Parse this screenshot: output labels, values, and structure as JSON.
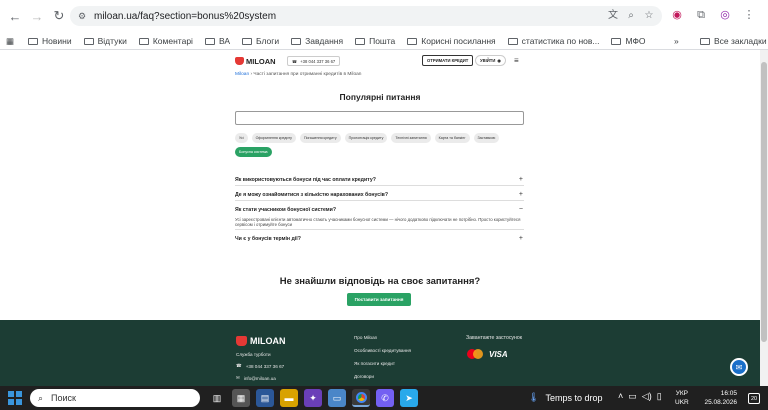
{
  "browser": {
    "url": "miloan.ua/faq?section=bonus%20system",
    "bookmarks": [
      "Новини",
      "Відтуки",
      "Коментарі",
      "ВА",
      "Блоги",
      "Завдання",
      "Пошта",
      "Корисні посилання",
      "статистика по нов...",
      "МФО"
    ],
    "all_bookmarks": "Все закладки"
  },
  "site": {
    "logo": "MILOAN",
    "phone": "+38 044 337 36 67",
    "get_credit": "ОТРИМАТИ КРЕДИТ",
    "login": "УВІЙТИ",
    "breadcrumb_home": "Miloan",
    "breadcrumb_current": "Часті запитання при отриманні кредитів в Miloan",
    "page_title": "Популярні питання",
    "chips": [
      "Усі",
      "Оформлення кредиту",
      "Погашення кредиту",
      "Пролонгація кредиту",
      "Технічні запитання",
      "Карта та банкінг",
      "Заставкою",
      "Бонусна система"
    ],
    "active_chip_index": 7,
    "faq": [
      {
        "q": "Як використовуються бонуси під час оплати кредиту?",
        "a": "",
        "open": false
      },
      {
        "q": "Де я можу ознайомитися з кількістю нарахованих бонусів?",
        "a": "",
        "open": false
      },
      {
        "q": "Як стати учасником бонусної системи?",
        "a": "Усі зареєстровані клієнти автоматично стають учасниками бонусної системи — нічого додатково підключати не потрібно. Просто користуйтеся сервісом і отримуйте бонуси",
        "open": true
      },
      {
        "q": "Чи є у бонусів термін дії?",
        "a": "",
        "open": false
      }
    ],
    "not_found_title": "Не знайшли відповідь на своє запитання?",
    "ask_button": "Поставити запитання",
    "footer": {
      "logo": "MILOAN",
      "support": "Служба турботи",
      "phone": "+38 044 337 36 67",
      "email": "info@miloan.ua",
      "links": [
        "Про Miloan",
        "Особливості кредитування",
        "Як погасити кредит",
        "Договори"
      ],
      "apps_title": "Завантажте застосунок",
      "visa": "VISA"
    }
  },
  "taskbar": {
    "search": "Поиск",
    "weather": "Temps to drop",
    "lang_top": "УКР",
    "lang_bottom": "UKR",
    "time": "16:05",
    "date": "25.08.2026",
    "notifications": "20"
  }
}
